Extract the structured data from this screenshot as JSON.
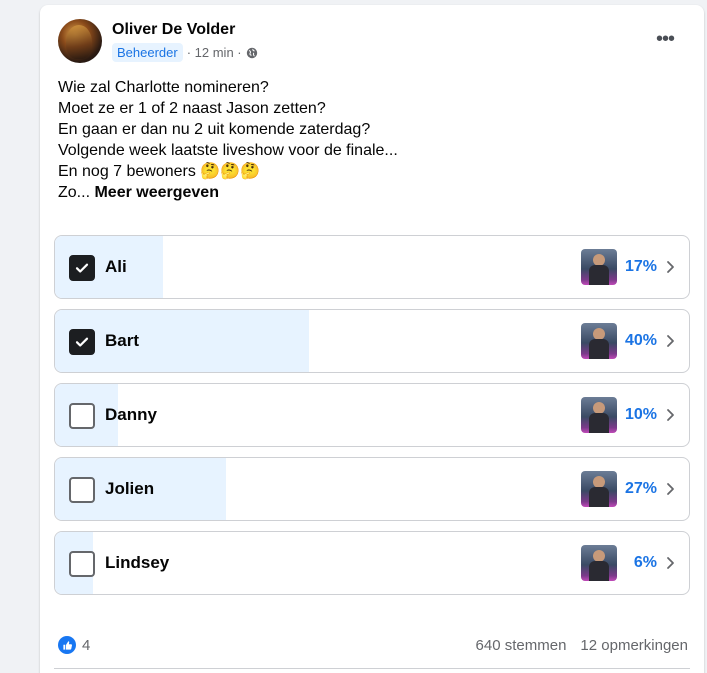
{
  "post": {
    "author": "Oliver De Volder",
    "role": "Beheerder",
    "time": "· 12 min ·",
    "more_label": "•••",
    "text_lines": [
      "Wie zal Charlotte nomineren?",
      "Moet ze er 1 of 2 naast Jason zetten?",
      "En gaan er dan nu 2 uit komende zaterdag?",
      "Volgende week laatste liveshow voor de finale...",
      "En nog 7 bewoners 🤔🤔🤔"
    ],
    "truncated_prefix": "Zo...",
    "see_more": "Meer weergeven"
  },
  "poll": {
    "options": [
      {
        "label": "Ali",
        "percent_text": "17%",
        "percent": 17,
        "checked": true
      },
      {
        "label": "Bart",
        "percent_text": "40%",
        "percent": 40,
        "checked": true
      },
      {
        "label": "Danny",
        "percent_text": "10%",
        "percent": 10,
        "checked": false
      },
      {
        "label": "Jolien",
        "percent_text": "27%",
        "percent": 27,
        "checked": false
      },
      {
        "label": "Lindsey",
        "percent_text": "6%",
        "percent": 6,
        "checked": false
      }
    ]
  },
  "footer": {
    "like_count": "4",
    "votes": "640 stemmen",
    "comments": "12 opmerkingen"
  },
  "colors": {
    "accent": "#1b74e4",
    "fill": "#e7f3ff",
    "like": "#1877f2"
  },
  "icons": {
    "more": "more-horizontal-icon",
    "globe": "globe-icon",
    "check": "check-icon",
    "chevron": "chevron-right-icon",
    "like": "like-icon"
  }
}
